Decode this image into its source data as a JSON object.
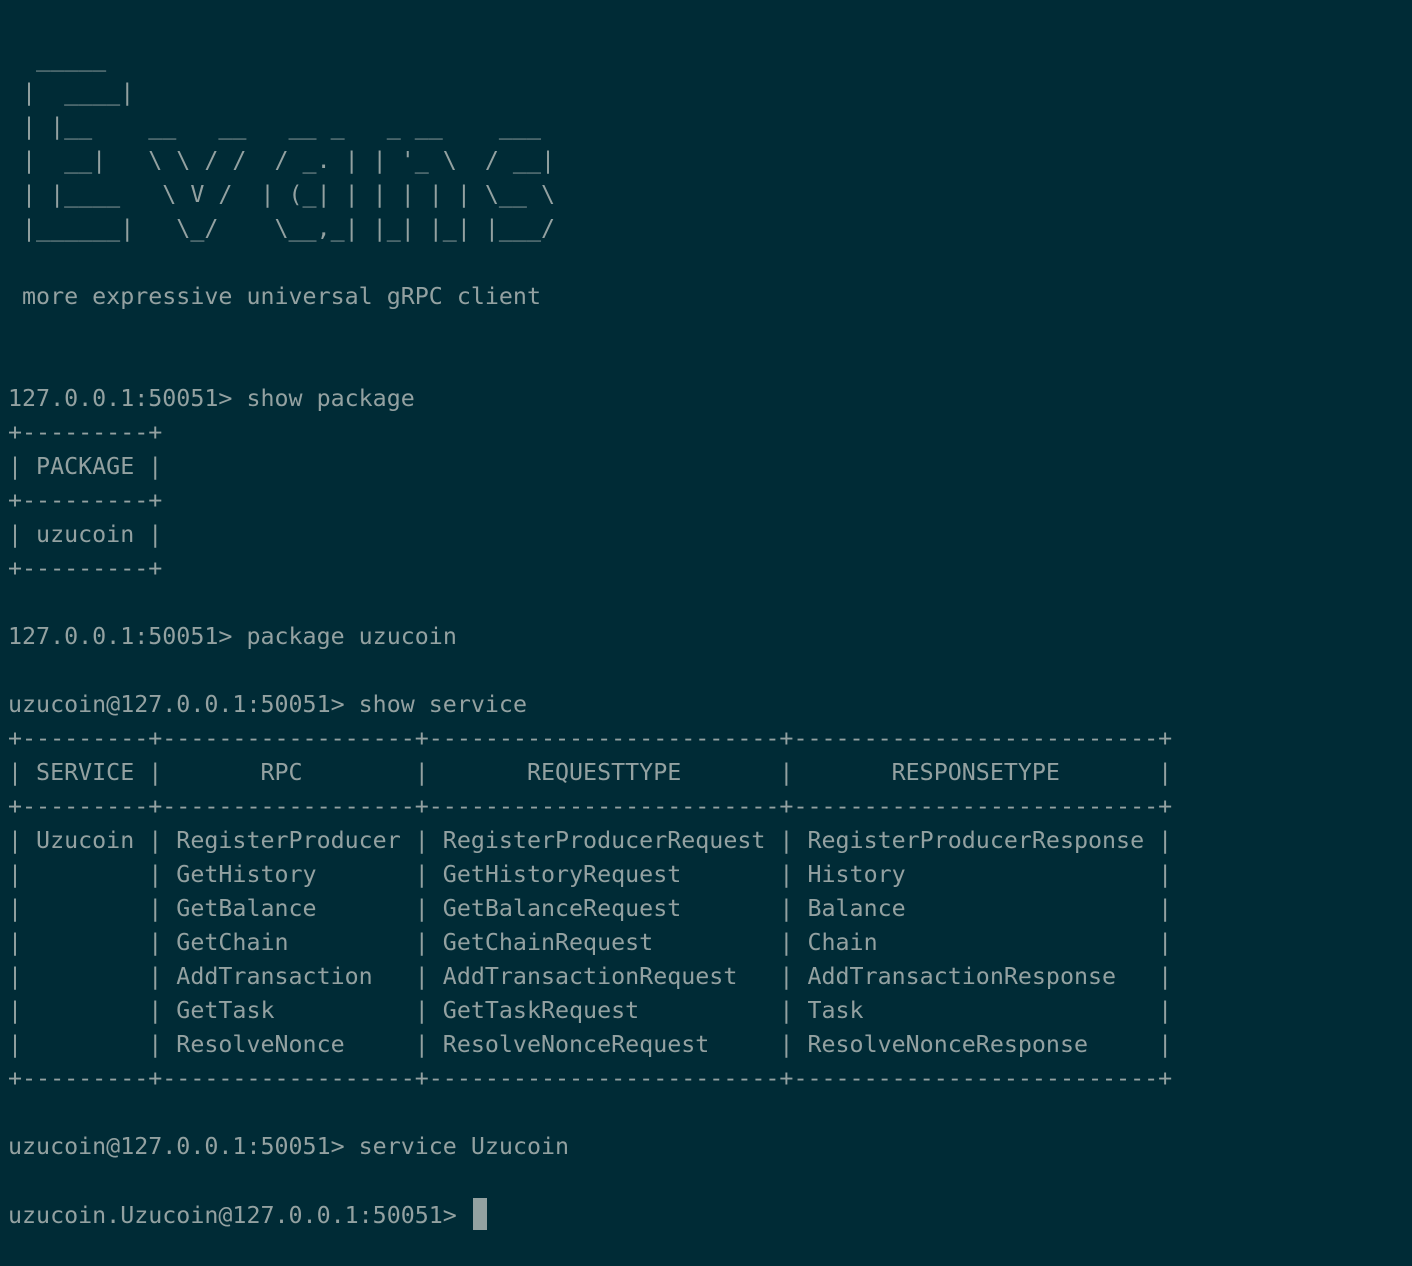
{
  "banner": [
    "  _____",
    " |  ____|",
    " | |__    __   __   __ _   _ __    ___",
    " |  __|   \\ \\ / /  / _. | | '_ \\  / __|",
    " | |____   \\ V /  | (_| | | | | | \\__ \\",
    " |______|   \\_/    \\__,_| |_| |_| |___/"
  ],
  "tagline": " more expressive universal gRPC client",
  "session": [
    {
      "prompt": "127.0.0.1:50051> ",
      "command": "show package"
    },
    {
      "table": [
        "+---------+",
        "| PACKAGE |",
        "+---------+",
        "| uzucoin |",
        "+---------+"
      ]
    },
    {
      "prompt": "127.0.0.1:50051> ",
      "command": "package uzucoin"
    },
    {
      "prompt": "uzucoin@127.0.0.1:50051> ",
      "command": "show service"
    },
    {
      "table": [
        "+---------+------------------+-------------------------+--------------------------+",
        "| SERVICE |       RPC        |       REQUESTTYPE       |       RESPONSETYPE       |",
        "+---------+------------------+-------------------------+--------------------------+",
        "| Uzucoin | RegisterProducer | RegisterProducerRequest | RegisterProducerResponse |",
        "|         | GetHistory       | GetHistoryRequest       | History                  |",
        "|         | GetBalance       | GetBalanceRequest       | Balance                  |",
        "|         | GetChain         | GetChainRequest         | Chain                    |",
        "|         | AddTransaction   | AddTransactionRequest   | AddTransactionResponse   |",
        "|         | GetTask          | GetTaskRequest          | Task                     |",
        "|         | ResolveNonce     | ResolveNonceRequest     | ResolveNonceResponse     |",
        "+---------+------------------+-------------------------+--------------------------+"
      ]
    },
    {
      "prompt": "uzucoin@127.0.0.1:50051> ",
      "command": "service Uzucoin"
    }
  ],
  "current_prompt": "uzucoin.Uzucoin@127.0.0.1:50051> ",
  "colors": {
    "background": "#002b36",
    "foreground": "#93a1a1",
    "cursor": "#93a1a1"
  }
}
